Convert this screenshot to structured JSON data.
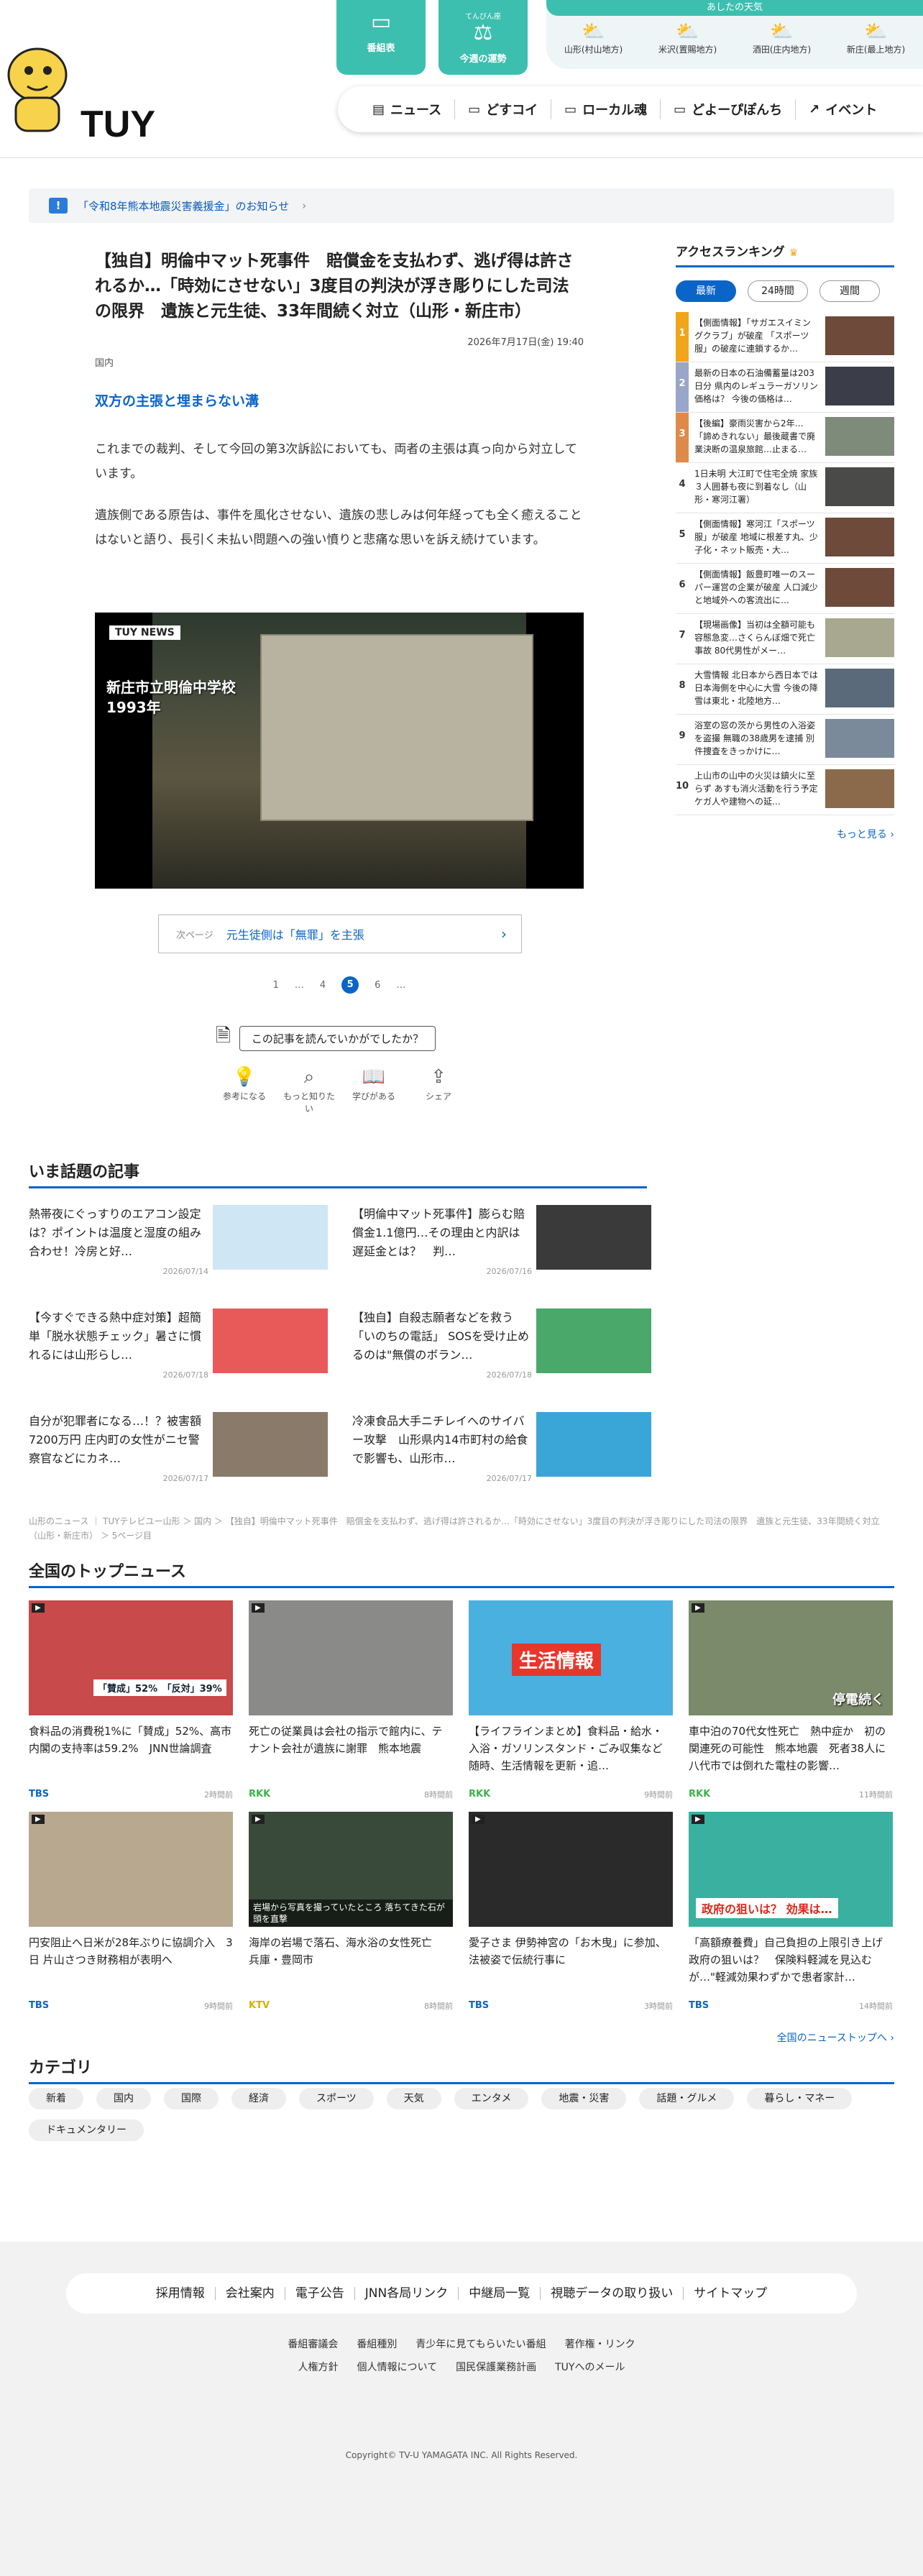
{
  "header": {
    "logo_text": "TUY",
    "tiles": [
      {
        "small": "",
        "label": "番組表",
        "icon": "tv-icon"
      },
      {
        "small": "てんびん座",
        "label": "今週の運勢",
        "icon": "scale-icon"
      }
    ],
    "weather_title": "あしたの天気",
    "weather": [
      {
        "region": "山形(村山地方)"
      },
      {
        "region": "米沢(置賜地方)"
      },
      {
        "region": "酒田(庄内地方)"
      },
      {
        "region": "新庄(最上地方)"
      }
    ],
    "nav": [
      "ニュース",
      "どすコイ",
      "ローカル魂",
      "どよーぴぽんち",
      "イベント"
    ]
  },
  "notice": {
    "icon": "!",
    "text": "「令和8年熊本地震災害義援金」のお知らせ"
  },
  "article": {
    "title": "【独自】明倫中マット死事件　賠償金を支払わず、逃げ得は許されるか…「時効にさせない」3度目の判決が浮き彫りにした司法の限界　遺族と元生徒、33年間続く対立（山形・新庄市）",
    "date": "2026年7月17日(金) 19:40",
    "category": "国内",
    "subheading": "双方の主張と埋まらない溝",
    "para1": "これまでの裁判、そして今回の第3次訴訟においても、両者の主張は真っ向から対立しています。",
    "para2": "遺族側である原告は、事件を風化させない、遺族の悲しみは何年経っても全く癒えることはないと語り、長引く未払い問題への強い憤りと悲痛な思いを訴え続けています。",
    "photo_badge": "TUY NEWS",
    "photo_cap1": "新庄市立明倫中学校",
    "photo_cap2": "1993年",
    "next_label": "次ページ",
    "next_title": "元生徒側は「無罪」を主張",
    "pager": [
      "1",
      "…",
      "4",
      "5",
      "6",
      "…"
    ],
    "feedback_question": "この記事を読んでいかがでしたか？",
    "reactions": [
      "参考になる",
      "もっと知りたい",
      "学びがある",
      "シェア"
    ]
  },
  "ranking": {
    "title": "アクセスランキング",
    "tabs": [
      "最新",
      "24時間",
      "週間"
    ],
    "items": [
      {
        "rank": "1",
        "text": "【側面情報】「サガエスイミングクラブ」が破産 「スポーツ服」の破産に連鎖するか…"
      },
      {
        "rank": "2",
        "text": "最新の日本の石油備蓄量は203日分 県内のレギュラーガソリン価格は？ 今後の価格は…"
      },
      {
        "rank": "3",
        "text": "【後編】豪雨災害から2年…「諦めきれない」最後蔵書で廃業決断の温泉旅館…止まる…"
      },
      {
        "rank": "4",
        "text": "1日未明 大江町で住宅全焼 家族３人囲碁も夜に到着なし（山形・寒河江署）"
      },
      {
        "rank": "5",
        "text": "【側面情報】寒河江「スポーツ服」が破産 地域に根差す丸、少子化・ネット販売・大…"
      },
      {
        "rank": "6",
        "text": "【側面情報】飯豊町唯一のスーパー運営の企業が破産 人口減少と地域外への客流出に…"
      },
      {
        "rank": "7",
        "text": "【現場画像】当初は全額可能も容態急変…さくらんぼ畑で死亡事故 80代男性がメー…"
      },
      {
        "rank": "8",
        "text": "大雪情報 北日本から西日本では日本海側を中心に大雪 今後の降雪は東北・北陸地方…"
      },
      {
        "rank": "9",
        "text": "浴室の窓の茨から男性の入浴姿を盗撮 無職の38歳男を逮捕 別件捜査をきっかけに…"
      },
      {
        "rank": "10",
        "text": "上山市の山中の火災は鎮火に至らず あすも消火活動を行う予定 ケガ人や建物への延…"
      }
    ],
    "more": "もっと見る"
  },
  "wadai": {
    "title": "いま話題の記事",
    "items": [
      {
        "title": "熱帯夜にぐっすりのエアコン設定は？ポイントは温度と湿度の組み合わせ！冷房と好…",
        "date": "2026/07/14"
      },
      {
        "title": "【明倫中マット死事件】膨らむ賠償金1.1億円…その理由と内訳は　遅延金とは？　判…",
        "date": "2026/07/16"
      },
      {
        "title": "【今すぐできる熱中症対策】超簡単「脱水状態チェック」暑さに慣れるには山形らし…",
        "date": "2026/07/18"
      },
      {
        "title": "【独自】自殺志願者などを救う「いのちの電話」 SOSを受け止めるのは\"無償のボラン…",
        "date": "2026/07/18"
      },
      {
        "title": "自分が犯罪者になる…！？被害額7200万円 庄内町の女性がニセ警察官などにカネ…",
        "date": "2026/07/17"
      },
      {
        "title": "冷凍食品大手ニチレイへのサイバー攻撃　山形県内14市町村の給食で影響も、山形市…",
        "date": "2026/07/17"
      }
    ]
  },
  "breadcrumb": "山形のニュース ｜ TUYテレビユー山形 ＞ 国内 ＞ 【独自】明倫中マット死事件　賠償金を支払わず、逃げ得は許されるか…「時効にさせない」3度目の判決が浮き彫りにした司法の限界　遺族と元生徒、33年間続く対立（山形・新庄市） ＞ 5ページ目",
  "zenkoku": {
    "title": "全国のトップニュース",
    "items": [
      {
        "title": "食料品の消費税1%に「賛成」52%、高市内閣の支持率は59.2%　JNN世論調査",
        "source": "TBS",
        "time": "2時間前",
        "img_overlay": "「賛成」52%　「反対」39%"
      },
      {
        "title": "死亡の従業員は会社の指示で館内に、テナント会社が遺族に謝罪　熊本地震",
        "source": "RKK",
        "time": "8時間前",
        "img_overlay": ""
      },
      {
        "title": "【ライフラインまとめ】食料品・給水・入浴・ガソリンスタンド・ごみ収集など　随時、生活情報を更新・追…",
        "source": "RKK",
        "time": "9時間前",
        "img_overlay": "生活情報"
      },
      {
        "title": "車中泊の70代女性死亡　熱中症か　初の関連死の可能性　熊本地震　死者38人に　八代市では倒れた電柱の影響…",
        "source": "RKK",
        "time": "11時間前",
        "img_overlay": "停電続く"
      },
      {
        "title": "円安阻止へ日米が28年ぶりに協調介入　3日 片山さつき財務相が表明へ",
        "source": "TBS",
        "time": "9時間前",
        "img_overlay": ""
      },
      {
        "title": "海岸の岩場で落石、海水浴の女性死亡　兵庫・豊岡市",
        "source": "KTV",
        "time": "8時間前",
        "img_overlay": "岩場から写真を撮っていたところ 落ちてきた石が頭を直撃"
      },
      {
        "title": "愛子さま 伊勢神宮の「お木曳」に参加、法被姿で伝統行事に",
        "source": "TBS",
        "time": "3時間前",
        "img_overlay": ""
      },
      {
        "title": "「高額療養費」自己負担の上限引き上げ　政府の狙いは？　保険料軽減を見込むが…\"軽減効果わずかで患者家計…",
        "source": "TBS",
        "time": "14時間前",
        "img_overlay": "政府の狙いは？ 効果は…"
      }
    ],
    "more": "全国のニューストップへ"
  },
  "category": {
    "title": "カテゴリ",
    "items": [
      "新着",
      "国内",
      "国際",
      "経済",
      "スポーツ",
      "天気",
      "エンタメ",
      "地震・災害",
      "話題・グルメ",
      "暮らし・マネー",
      "ドキュメンタリー"
    ]
  },
  "footer": {
    "links": [
      "採用情報",
      "会社案内",
      "電子公告",
      "JNN各局リンク",
      "中継局一覧",
      "視聴データの取り扱い",
      "サイトマップ"
    ],
    "sub1": [
      "番組審議会",
      "番組種別",
      "青少年に見てもらいたい番組",
      "著作権・リンク"
    ],
    "sub2": [
      "人権方針",
      "個人情報について",
      "国民保護業務計画",
      "TUYへのメール"
    ],
    "copyright": "Copyright© TV-U YAMAGATA INC. All Rights Reserved."
  },
  "colors": {
    "accent": "#0b65c8",
    "teal": "#3cbfaf",
    "gold": "#f1a51c"
  }
}
